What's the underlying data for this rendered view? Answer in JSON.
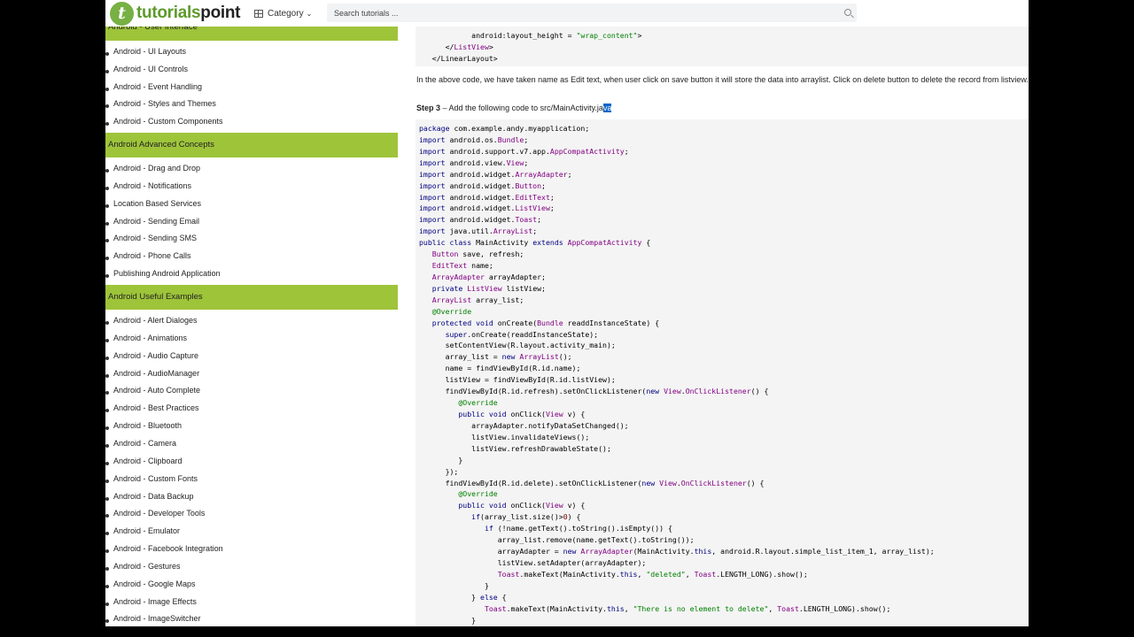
{
  "header": {
    "logo_a": "tutorials",
    "logo_b": "point",
    "category_label": "Category",
    "search_placeholder": "Search tutorials ..."
  },
  "sidebar": {
    "section_user_interface": "Android - User Interface",
    "ui_items": [
      "Android - UI Layouts",
      "Android - UI Controls",
      "Android - Event Handling",
      "Android - Styles and Themes",
      "Android - Custom Components"
    ],
    "section_advanced": "Android Advanced Concepts",
    "advanced_items": [
      "Android - Drag and Drop",
      "Android - Notifications",
      "Location Based Services",
      "Android - Sending Email",
      "Android - Sending SMS",
      "Android - Phone Calls",
      "Publishing Android Application"
    ],
    "section_useful": "Android Useful Examples",
    "useful_items": [
      "Android - Alert Dialoges",
      "Android - Animations",
      "Android - Audio Capture",
      "Android - AudioManager",
      "Android - Auto Complete",
      "Android - Best Practices",
      "Android - Bluetooth",
      "Android - Camera",
      "Android - Clipboard",
      "Android - Custom Fonts",
      "Android - Data Backup",
      "Android - Developer Tools",
      "Android - Emulator",
      "Android - Facebook Integration",
      "Android - Gestures",
      "Android - Google Maps",
      "Android - Image Effects",
      "Android - ImageSwitcher"
    ]
  },
  "content": {
    "top_code": [
      "            android:layout_height = \"wrap_content\">",
      "      </ListView>",
      "   </LinearLayout>"
    ],
    "description": "In the above code, we have taken name as Edit text, when user click on save button it will store the data into arraylist. Click on delete button to delete the record from listview.",
    "step_label": "Step 3",
    "step_text": " – Add the following code to src/MainActivity.ja",
    "step_selected": "va",
    "main_code": [
      "package com.example.andy.myapplication;",
      "import android.os.Bundle;",
      "import android.support.v7.app.AppCompatActivity;",
      "import android.view.View;",
      "import android.widget.ArrayAdapter;",
      "import android.widget.Button;",
      "import android.widget.EditText;",
      "import android.widget.ListView;",
      "import android.widget.Toast;",
      "import java.util.ArrayList;",
      "public class MainActivity extends AppCompatActivity {",
      "   Button save, refresh;",
      "   EditText name;",
      "   ArrayAdapter arrayAdapter;",
      "   private ListView listView;",
      "   ArrayList array_list;",
      "   @Override",
      "   protected void onCreate(Bundle readdInstanceState) {",
      "      super.onCreate(readdInstanceState);",
      "      setContentView(R.layout.activity_main);",
      "      array_list = new ArrayList();",
      "      name = findViewById(R.id.name);",
      "      listView = findViewById(R.id.listView);",
      "      findViewById(R.id.refresh).setOnClickListener(new View.OnClickListener() {",
      "         @Override",
      "         public void onClick(View v) {",
      "            arrayAdapter.notifyDataSetChanged();",
      "            listView.invalidateViews();",
      "            listView.refreshDrawableState();",
      "         }",
      "      });",
      "      findViewById(R.id.delete).setOnClickListener(new View.OnClickListener() {",
      "         @Override",
      "         public void onClick(View v) {",
      "            if(array_list.size()>0) {",
      "               if (!name.getText().toString().isEmpty()) {",
      "                  array_list.remove(name.getText().toString());",
      "                  arrayAdapter = new ArrayAdapter(MainActivity.this, android.R.layout.simple_list_item_1, array_list);",
      "                  listView.setAdapter(arrayAdapter);",
      "                  Toast.makeText(MainActivity.this, \"deleted\", Toast.LENGTH_LONG).show();",
      "               }",
      "            } else {",
      "               Toast.makeText(MainActivity.this, \"There is no element to delete\", Toast.LENGTH_LONG).show();",
      "            }"
    ]
  }
}
